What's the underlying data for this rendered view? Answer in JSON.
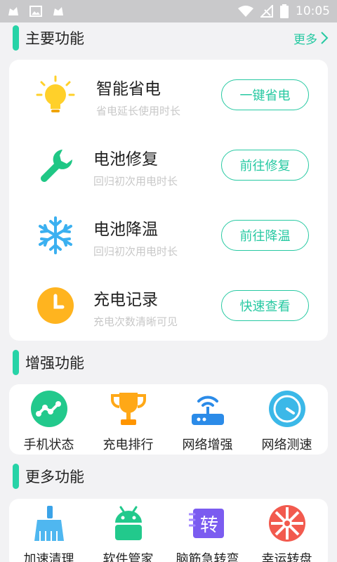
{
  "status_bar": {
    "time": "10:05"
  },
  "main_section": {
    "title": "主要功能",
    "more_label": "更多",
    "features": [
      {
        "icon": "lightbulb-icon",
        "title": "智能省电",
        "subtitle": "省电延长使用时长",
        "button": "一键省电"
      },
      {
        "icon": "wrench-icon",
        "title": "电池修复",
        "subtitle": "回归初次用电时长",
        "button": "前往修复"
      },
      {
        "icon": "snowflake-icon",
        "title": "电池降温",
        "subtitle": "回归初次用电时长",
        "button": "前往降温"
      },
      {
        "icon": "clock-icon",
        "title": "充电记录",
        "subtitle": "充电次数清晰可见",
        "button": "快速查看"
      }
    ]
  },
  "enhance_section": {
    "title": "增强功能",
    "items": [
      {
        "icon": "phone-status-icon",
        "label": "手机状态"
      },
      {
        "icon": "trophy-icon",
        "label": "充电排行"
      },
      {
        "icon": "router-icon",
        "label": "网络增强"
      },
      {
        "icon": "speedometer-icon",
        "label": "网络测速"
      }
    ]
  },
  "more_section": {
    "title": "更多功能",
    "items": [
      {
        "icon": "broom-icon",
        "label": "加速清理"
      },
      {
        "icon": "android-icon",
        "label": "软件管家"
      },
      {
        "icon": "brain-teaser-icon",
        "label": "脑筋急转弯",
        "icon_text": "转"
      },
      {
        "icon": "lucky-wheel-icon",
        "label": "幸运转盘"
      }
    ]
  },
  "colors": {
    "accent": "#27c9a2",
    "bulb": "#ffd02a",
    "wrench": "#1fc785",
    "snow": "#3bb0f0",
    "clock": "#ffb41f"
  }
}
